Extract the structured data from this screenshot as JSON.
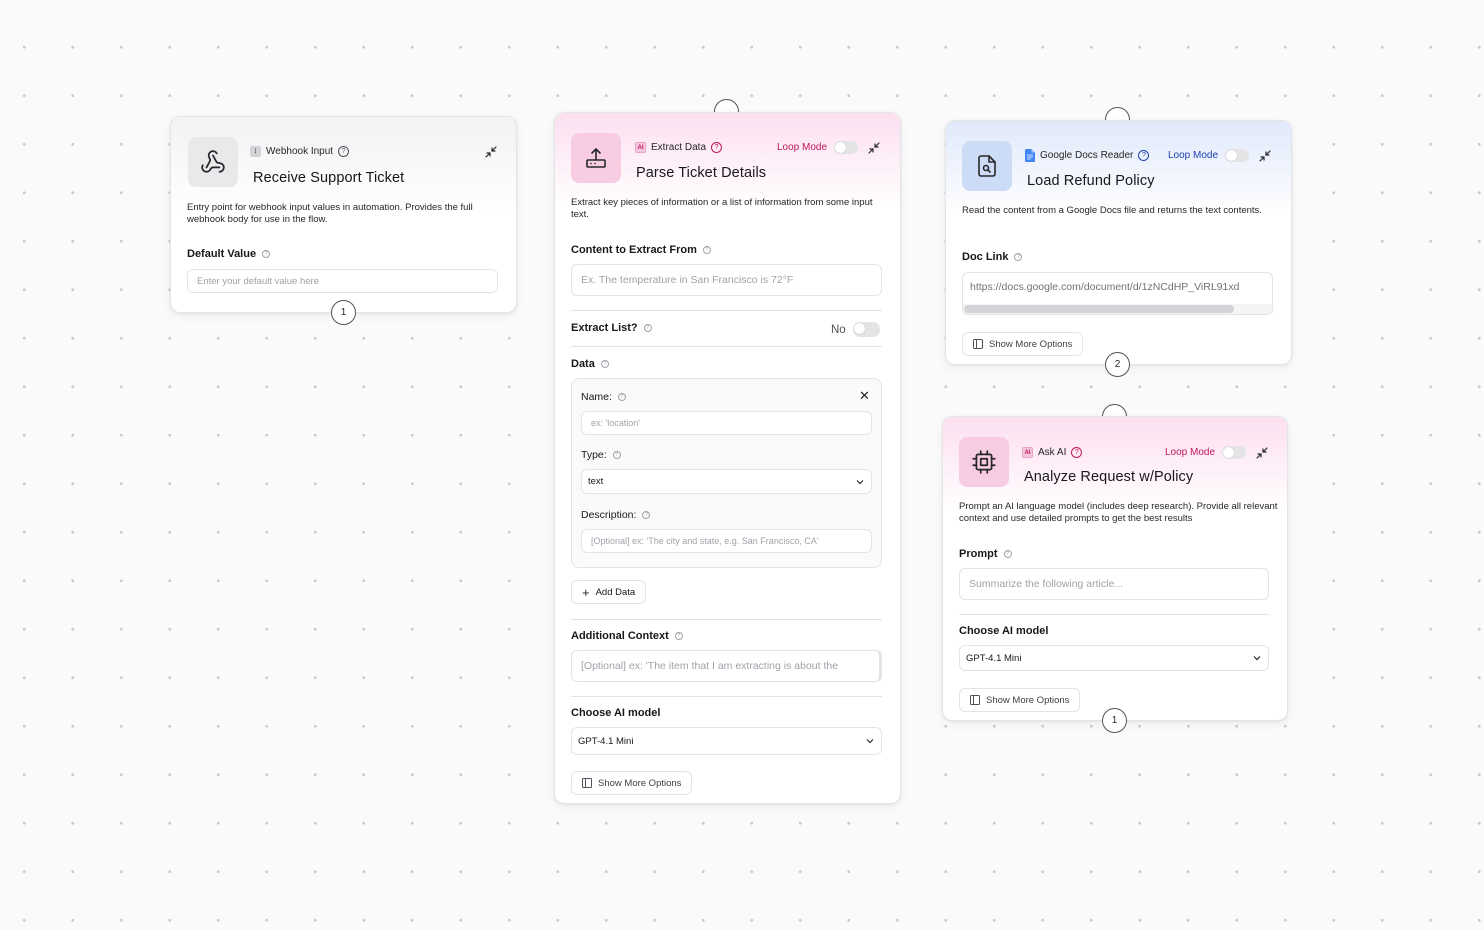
{
  "colors": {
    "pink_accent": "#be185d",
    "blue_accent": "#1e40af",
    "border": "#e4e4e7",
    "canvas_dot": "#c9c9cf"
  },
  "nodes": {
    "webhook": {
      "type_label": "Webhook Input",
      "title": "Receive Support Ticket",
      "description": "Entry point for webhook input values in automation. Provides the full webhook body for use in the flow.",
      "default_value_label": "Default Value",
      "default_value_placeholder": "Enter your default value here",
      "count": "1",
      "icon": "webhook-icon"
    },
    "extract": {
      "type_label": "Extract Data",
      "loop_mode_label": "Loop Mode",
      "title": "Parse Ticket Details",
      "description": "Extract key pieces of information or a list of information from some input text.",
      "content_label": "Content to Extract From",
      "content_placeholder": "Ex. The temperature in San Francisco is 72°F",
      "extract_list_label": "Extract List?",
      "extract_list_value": "No",
      "data_label": "Data",
      "name_label": "Name:",
      "name_placeholder": "ex: 'location'",
      "type_field_label": "Type:",
      "type_value": "text",
      "description_field_label": "Description:",
      "description_placeholder": "[Optional] ex: 'The city and state, e.g. San Francisco, CA'",
      "add_data_label": "Add Data",
      "additional_context_label": "Additional Context",
      "additional_context_placeholder": "[Optional] ex: 'The item that I am extracting is about the",
      "model_label": "Choose AI model",
      "model_value": "GPT-4.1 Mini",
      "show_more_label": "Show More Options",
      "icon": "upload-tray-icon"
    },
    "docs": {
      "type_label": "Google Docs Reader",
      "loop_mode_label": "Loop Mode",
      "title": "Load Refund Policy",
      "description": "Read the content from a Google Docs file and returns the text contents.",
      "doc_link_label": "Doc Link",
      "doc_link_value": "https://docs.google.com/document/d/1zNCdHP_ViRL91xd",
      "show_more_label": "Show More Options",
      "count": "2",
      "icon": "document-search-icon"
    },
    "ask": {
      "type_label": "Ask AI",
      "loop_mode_label": "Loop Mode",
      "title": "Analyze Request w/Policy",
      "description": "Prompt an AI language model (includes deep research). Provide all relevant context and use detailed prompts to get the best results",
      "prompt_label": "Prompt",
      "prompt_placeholder": "Summarize the following article...",
      "model_label": "Choose AI model",
      "model_value": "GPT-4.1 Mini",
      "show_more_label": "Show More Options",
      "count": "1",
      "icon": "cpu-chip-icon"
    }
  }
}
